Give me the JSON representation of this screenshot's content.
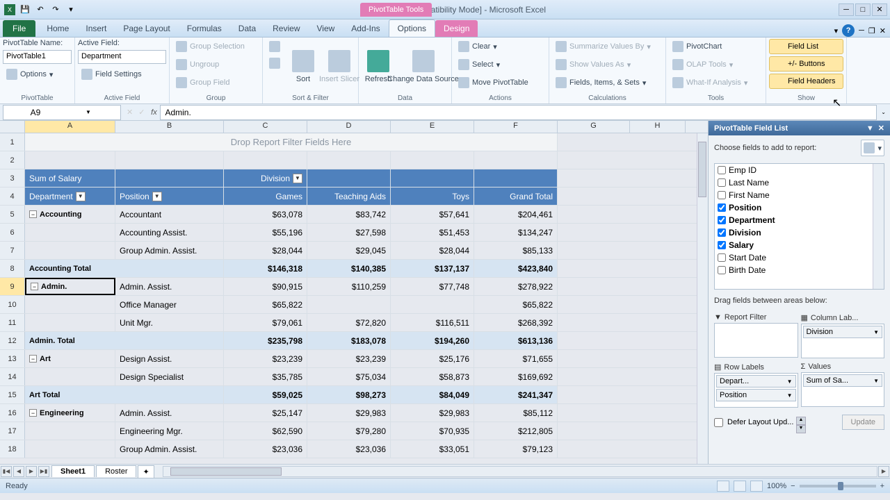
{
  "title": "roster.xls  [Compatibility Mode] - Microsoft Excel",
  "context_title": "PivotTable Tools",
  "tabs": [
    "Home",
    "Insert",
    "Page Layout",
    "Formulas",
    "Data",
    "Review",
    "View",
    "Add-Ins"
  ],
  "ctx_tabs": [
    "Options",
    "Design"
  ],
  "file_tab": "File",
  "ribbon": {
    "pt_name_lbl": "PivotTable Name:",
    "pt_name": "PivotTable1",
    "options": "Options",
    "active_lbl": "Active Field:",
    "active_field": "Department",
    "field_settings": "Field Settings",
    "group_sel": "Group Selection",
    "ungroup": "Ungroup",
    "group_field": "Group Field",
    "sort": "Sort",
    "insert_slicer": "Insert Slicer",
    "refresh": "Refresh",
    "change_ds": "Change Data Source",
    "clear": "Clear",
    "select": "Select",
    "move": "Move PivotTable",
    "sumvals": "Summarize Values By",
    "showvals": "Show Values As",
    "fields_items": "Fields, Items, & Sets",
    "pivotchart": "PivotChart",
    "olap": "OLAP Tools",
    "whatif": "What-If Analysis",
    "fieldlist": "Field List",
    "pm_buttons": "+/- Buttons",
    "field_headers": "Field Headers",
    "g_pivot": "PivotTable",
    "g_active": "Active Field",
    "g_group": "Group",
    "g_sort": "Sort & Filter",
    "g_data": "Data",
    "g_actions": "Actions",
    "g_calc": "Calculations",
    "g_tools": "Tools",
    "g_show": "Show"
  },
  "namebox": "A9",
  "formula": "Admin.",
  "cols": [
    "A",
    "B",
    "C",
    "D",
    "E",
    "F",
    "G",
    "H"
  ],
  "drop_hint": "Drop Report Filter Fields Here",
  "pt_labels": {
    "measure": "Sum of Salary",
    "col": "Division",
    "row1": "Department",
    "row2": "Position",
    "gt": "Grand Total"
  },
  "divisions": [
    "Games",
    "Teaching Aids",
    "Toys"
  ],
  "rows": [
    {
      "n": 5,
      "a": "Accounting",
      "b": "Accountant",
      "c": "$63,078",
      "d": "$83,742",
      "e": "$57,641",
      "f": "$204,461",
      "exp": true
    },
    {
      "n": 6,
      "a": "",
      "b": "Accounting Assist.",
      "c": "$55,196",
      "d": "$27,598",
      "e": "$51,453",
      "f": "$134,247"
    },
    {
      "n": 7,
      "a": "",
      "b": "Group Admin. Assist.",
      "c": "$28,044",
      "d": "$29,045",
      "e": "$28,044",
      "f": "$85,133"
    },
    {
      "n": 8,
      "sub": true,
      "a": "Accounting Total",
      "c": "$146,318",
      "d": "$140,385",
      "e": "$137,137",
      "f": "$423,840"
    },
    {
      "n": 9,
      "a": "Admin.",
      "b": "Admin. Assist.",
      "c": "$90,915",
      "d": "$110,259",
      "e": "$77,748",
      "f": "$278,922",
      "exp": true,
      "sel": true
    },
    {
      "n": 10,
      "a": "",
      "b": "Office Manager",
      "c": "$65,822",
      "d": "",
      "e": "",
      "f": "$65,822"
    },
    {
      "n": 11,
      "a": "",
      "b": "Unit Mgr.",
      "c": "$79,061",
      "d": "$72,820",
      "e": "$116,511",
      "f": "$268,392"
    },
    {
      "n": 12,
      "sub": true,
      "a": "Admin. Total",
      "c": "$235,798",
      "d": "$183,078",
      "e": "$194,260",
      "f": "$613,136"
    },
    {
      "n": 13,
      "a": "Art",
      "b": "Design Assist.",
      "c": "$23,239",
      "d": "$23,239",
      "e": "$25,176",
      "f": "$71,655",
      "exp": true
    },
    {
      "n": 14,
      "a": "",
      "b": "Design Specialist",
      "c": "$35,785",
      "d": "$75,034",
      "e": "$58,873",
      "f": "$169,692"
    },
    {
      "n": 15,
      "sub": true,
      "a": "Art Total",
      "c": "$59,025",
      "d": "$98,273",
      "e": "$84,049",
      "f": "$241,347"
    },
    {
      "n": 16,
      "a": "Engineering",
      "b": "Admin. Assist.",
      "c": "$25,147",
      "d": "$29,983",
      "e": "$29,983",
      "f": "$85,112",
      "exp": true
    },
    {
      "n": 17,
      "a": "",
      "b": "Engineering Mgr.",
      "c": "$62,590",
      "d": "$79,280",
      "e": "$70,935",
      "f": "$212,805"
    },
    {
      "n": 18,
      "a": "",
      "b": "Group Admin. Assist.",
      "c": "$23,036",
      "d": "$23,036",
      "e": "$33,051",
      "f": "$79,123"
    }
  ],
  "fieldlist": {
    "title": "PivotTable Field List",
    "choose": "Choose fields to add to report:",
    "fields": [
      {
        "name": "Emp ID",
        "checked": false
      },
      {
        "name": "Last Name",
        "checked": false
      },
      {
        "name": "First Name",
        "checked": false
      },
      {
        "name": "Position",
        "checked": true
      },
      {
        "name": "Department",
        "checked": true
      },
      {
        "name": "Division",
        "checked": true
      },
      {
        "name": "Salary",
        "checked": true
      },
      {
        "name": "Start Date",
        "checked": false
      },
      {
        "name": "Birth Date",
        "checked": false
      }
    ],
    "drag": "Drag fields between areas below:",
    "area_filter": "Report Filter",
    "area_col": "Column Lab...",
    "area_row": "Row Labels",
    "area_val": "Values",
    "chips": {
      "col": "Division",
      "row1": "Depart...",
      "row2": "Position",
      "val": "Sum of Sa..."
    },
    "defer": "Defer Layout Upd...",
    "update": "Update"
  },
  "sheets": [
    "Sheet1",
    "Roster"
  ],
  "status": {
    "ready": "Ready",
    "zoom": "100%"
  }
}
